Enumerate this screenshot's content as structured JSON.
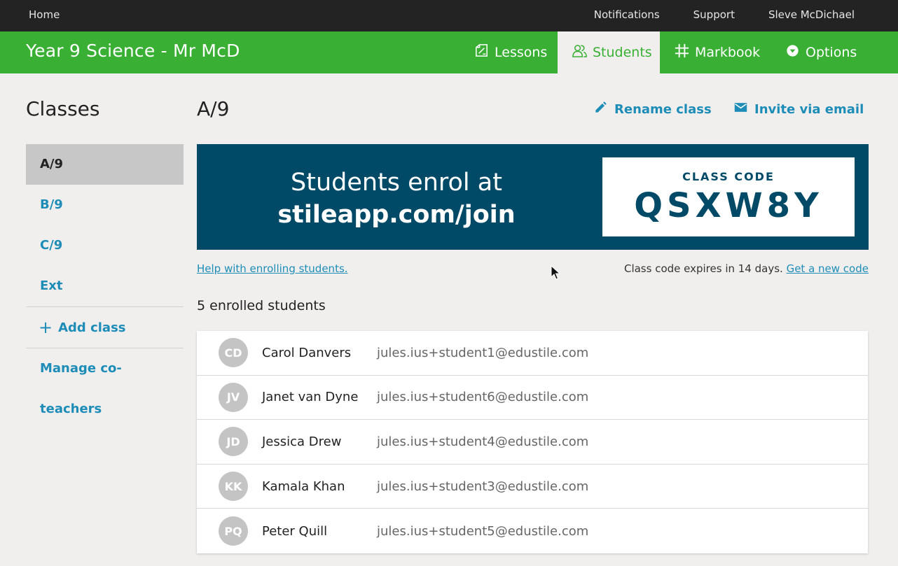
{
  "topbar": {
    "home": "Home",
    "notifications": "Notifications",
    "support": "Support",
    "user": "Sleve McDichael"
  },
  "header": {
    "title": "Year 9 Science - Mr McD",
    "tabs": {
      "lessons": "Lessons",
      "students": "Students",
      "markbook": "Markbook",
      "options": "Options"
    },
    "active_tab": "students",
    "accent": "#39b034"
  },
  "sidebar": {
    "title": "Classes",
    "classes": [
      "A/9",
      "B/9",
      "C/9",
      "Ext"
    ],
    "active_class": "A/9",
    "add_class": "Add class",
    "manage": "Manage co-teachers"
  },
  "main": {
    "class_name": "A/9",
    "rename": "Rename class",
    "invite": "Invite via email",
    "banner": {
      "line1": "Students enrol at",
      "line2": "stileapp.com/join",
      "code_label": "CLASS CODE",
      "code": "QSXW8Y",
      "color": "#004a68"
    },
    "help_link": "Help with enrolling students.",
    "expiry_text": "Class code expires in 14 days.",
    "new_code_link": "Get a new code",
    "enrolled_count": "5 enrolled students",
    "students": [
      {
        "initials": "CD",
        "name": "Carol Danvers",
        "email": "jules.ius+student1@edustile.com"
      },
      {
        "initials": "JV",
        "name": "Janet van Dyne",
        "email": "jules.ius+student6@edustile.com"
      },
      {
        "initials": "JD",
        "name": "Jessica Drew",
        "email": "jules.ius+student4@edustile.com"
      },
      {
        "initials": "KK",
        "name": "Kamala Khan",
        "email": "jules.ius+student3@edustile.com"
      },
      {
        "initials": "PQ",
        "name": "Peter Quill",
        "email": "jules.ius+student5@edustile.com"
      }
    ]
  }
}
